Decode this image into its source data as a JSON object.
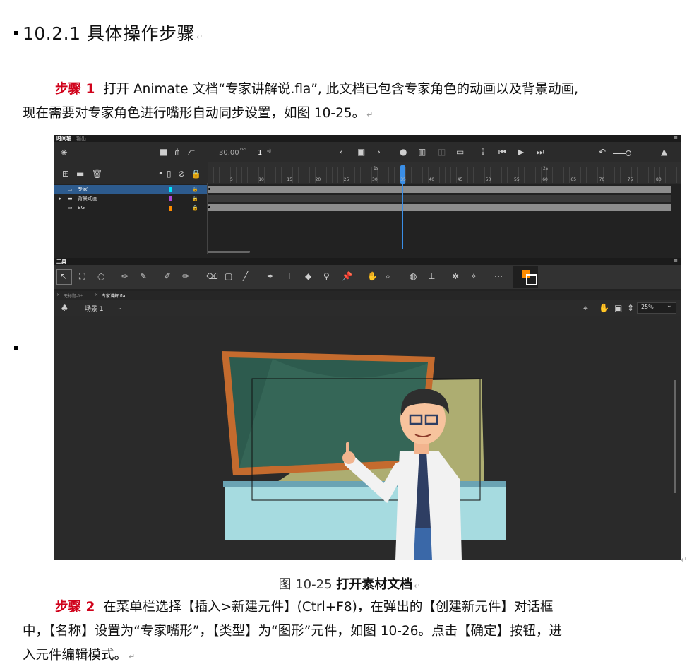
{
  "heading": "10.2.1 具体操作步骤",
  "para1": {
    "step": "步骤 1",
    "line1": "打开 Animate 文档“专家讲解说.fla”, 此文档已包含专家角色的动画以及背景动画,",
    "line2": "现在需要对专家角色进行嘴形自动同步设置，如图 10-25。"
  },
  "caption": {
    "prefix": "图  10-25",
    "title": "打开素材文档"
  },
  "para2": {
    "step": "步骤 2",
    "line1": "在菜单栏选择【插入>新建元件】(Ctrl+F8)，在弹出的【创建新元件】对话框",
    "line2": "中，【名称】设置为“专家嘴形”，【类型】为“图形”元件，如图 10-26。点击【确定】按钮，进",
    "line3": "入元件编辑模式。"
  },
  "app": {
    "timeline_tab": "时间轴",
    "output_tab": "输出",
    "fps": "30.00",
    "fps_unit": "FPS",
    "frame": "1",
    "frame_unit": "帧",
    "layers": [
      {
        "name": "专家",
        "color": "#00e5ff",
        "selected": true
      },
      {
        "name": "背景动画",
        "color": "#b04ad8",
        "selected": false
      },
      {
        "name": "BG",
        "color": "#ff8c00",
        "selected": false
      }
    ],
    "ruler_ticks": [
      "5",
      "10",
      "15",
      "20",
      "25",
      "30",
      "35",
      "40",
      "45",
      "50",
      "55",
      "60",
      "65",
      "70",
      "75",
      "80"
    ],
    "ruler_secs": [
      "1s",
      "2s"
    ],
    "tools_label": "工具",
    "doc_tabs": [
      "无标题-1*",
      "专家讲解.fla"
    ],
    "scene": "场景 1",
    "zoom": "25%",
    "stroke_color": "#ffffff",
    "fill_color": "#ff8c00"
  }
}
